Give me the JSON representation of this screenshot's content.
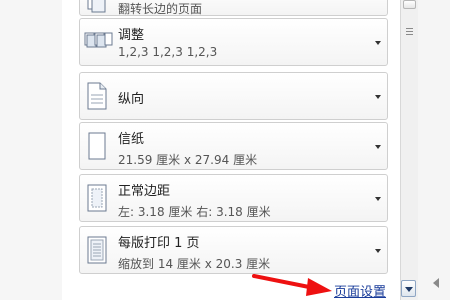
{
  "cards": [
    {
      "title": "翻转长边的页面",
      "sub": ""
    },
    {
      "title": "调整",
      "sub": "1,2,3    1,2,3    1,2,3"
    },
    {
      "title": "纵向",
      "sub": ""
    },
    {
      "title": "信纸",
      "sub": "21.59 厘米 x 27.94 厘米"
    },
    {
      "title": "正常边距",
      "sub": "左:  3.18 厘米     右:  3.18 厘米"
    },
    {
      "title": "每版打印 1 页",
      "sub": "缩放到 14 厘米 x 20.3 厘米"
    }
  ],
  "link": {
    "page_setup": "页面设置"
  },
  "icons": [
    "duplex-flip-icon",
    "collate-icon",
    "portrait-icon",
    "paper-size-icon",
    "margins-icon",
    "pages-per-sheet-icon",
    "dropdown-arrow-icon"
  ]
}
